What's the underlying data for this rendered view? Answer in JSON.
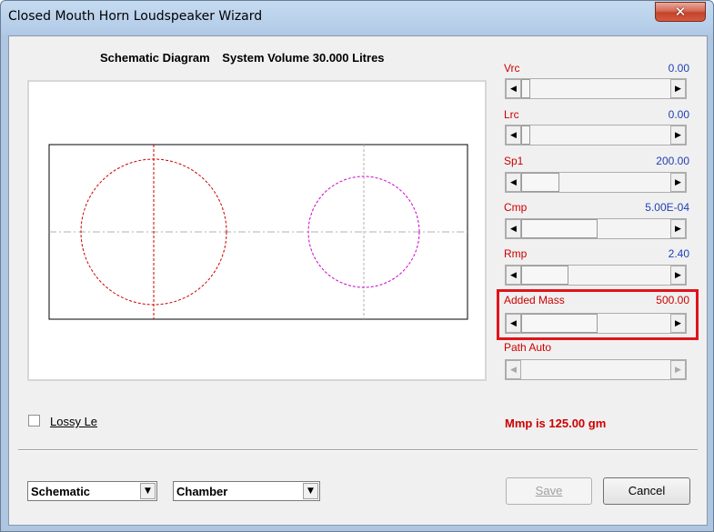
{
  "window": {
    "title": "Closed Mouth Horn Loudspeaker Wizard",
    "close_glyph": "✕"
  },
  "heading": {
    "label": "Schematic Diagram",
    "volume": "System Volume 30.000 Litres"
  },
  "params": [
    {
      "label": "Vrc",
      "value": "0.00",
      "level": 0.0
    },
    {
      "label": "Lrc",
      "value": "0.00",
      "level": 0.0
    },
    {
      "label": "Sp1",
      "value": "200.00",
      "level": 0.1
    },
    {
      "label": "Cmp",
      "value": "5.00E-04",
      "level": 0.5
    },
    {
      "label": "Rmp",
      "value": "2.40",
      "level": 0.15
    },
    {
      "label": "Added Mass",
      "value": "500.00",
      "level": 0.5
    },
    {
      "label": "Path  Auto",
      "value": "",
      "level": null
    }
  ],
  "arrows": {
    "left": "◀",
    "right": "▶",
    "down": "▼"
  },
  "options": {
    "lossy_le_label": "Lossy Le",
    "lossy_le_checked": false
  },
  "status": {
    "mmp": "Mmp is 125.00 gm"
  },
  "footer": {
    "view_select": "Schematic",
    "part_select": "Chamber",
    "save_label": "Save",
    "cancel_label": "Cancel"
  },
  "colors": {
    "accent_red": "#cc0000",
    "value_blue": "#1f3fb5",
    "highlight": "#e0141b"
  }
}
